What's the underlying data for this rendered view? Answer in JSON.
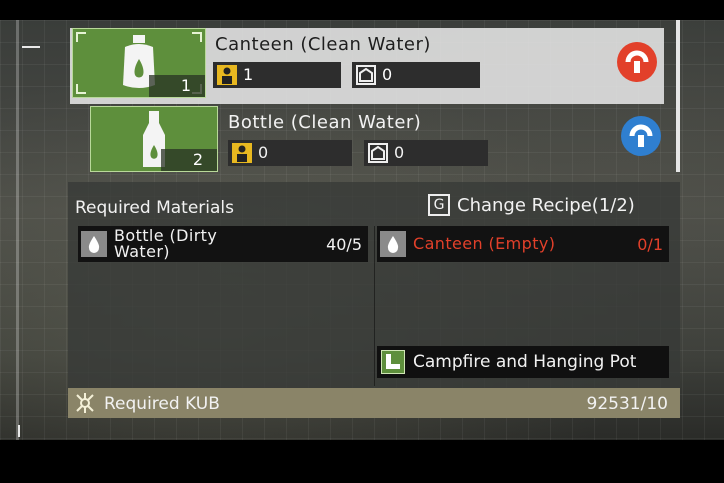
{
  "recipes": [
    {
      "name": "Canteen (Clean Water)",
      "quantity": "1",
      "stat_person": "1",
      "stat_container": "0",
      "tool_icon": "wrench-icon",
      "tool_color": "#e2402a",
      "item_icon": "canteen-icon",
      "selected": true
    },
    {
      "name": "Bottle (Clean Water)",
      "quantity": "2",
      "stat_person": "0",
      "stat_container": "0",
      "tool_icon": "wrench-icon",
      "tool_color": "#2f7fd0",
      "item_icon": "bottle-icon",
      "selected": false
    }
  ],
  "panel": {
    "title": "Required Materials",
    "change_recipe_key": "G",
    "change_recipe_label": "Change Recipe(1/2)",
    "materials": [
      {
        "name_line1": "Bottle (Dirty",
        "name_line2": "Water)",
        "count": "40/5",
        "sufficient": true,
        "icon": "water-drop-icon"
      },
      {
        "name_line1": "Canteen (Empty)",
        "count": "0/1",
        "sufficient": false,
        "icon": "water-drop-icon"
      }
    ],
    "station": "Campfire and Hanging Pot"
  },
  "kub": {
    "label": "Required KUB",
    "value": "92531/10",
    "icon": "kub-icon"
  },
  "colors": {
    "accent_green": "#5e8f3c",
    "warning_red": "#e2402a",
    "kub_bar": "#8a8468"
  }
}
